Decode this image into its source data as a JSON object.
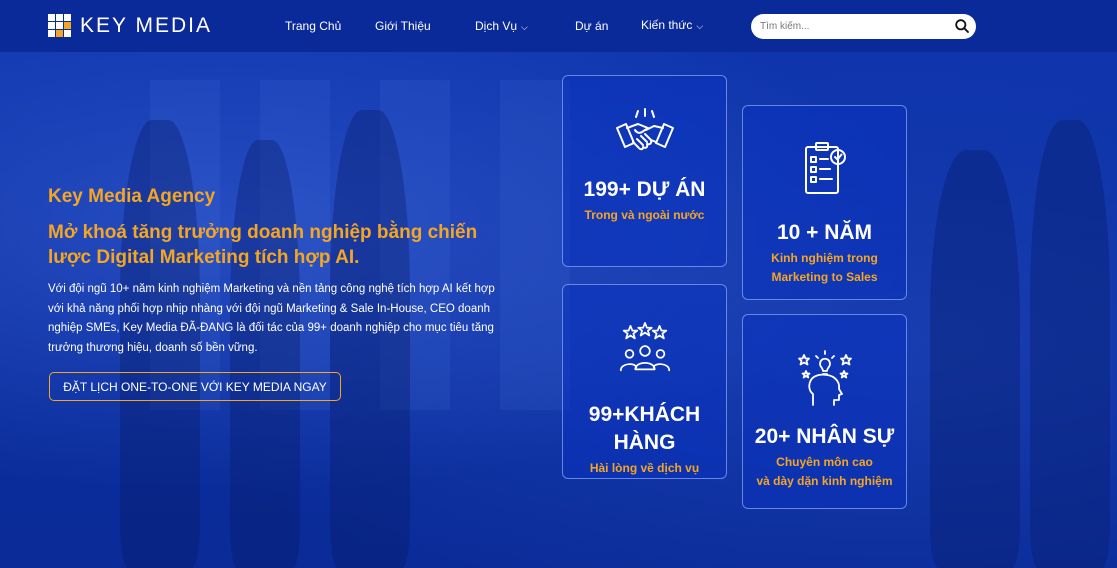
{
  "brand": {
    "name": "KEY MEDIA"
  },
  "nav": {
    "items": [
      {
        "label": "Trang Chủ",
        "has_dropdown": false
      },
      {
        "label": "Giới Thiệu",
        "has_dropdown": false
      },
      {
        "label": "Dịch Vụ",
        "has_dropdown": true
      },
      {
        "label": "Dự án",
        "has_dropdown": false
      },
      {
        "label": "Kiến thức",
        "has_dropdown": true
      }
    ],
    "dropdown_icon": "chevron-down-icon"
  },
  "search": {
    "placeholder": "Tìm kiếm...",
    "icon": "search-icon"
  },
  "hero": {
    "eyebrow": "Key Media Agency",
    "headline": "Mở khoá tăng trưởng doanh nghiệp bằng chiến lược Digital Marketing tích hợp AI.",
    "description": "Với đội ngũ 10+ năm kinh nghiệm Marketing và nền tảng công nghệ tích hợp AI kết hợp với khả năng phối hợp nhịp nhàng với đội ngũ Marketing & Sale In-House, CEO doanh nghiệp SMEs, Key Media ĐÃ-ĐANG là đối tác của 99+ doanh nghiệp cho mục tiêu tăng trưởng thương hiệu, doanh số bền vững.",
    "cta_label": "ĐẶT LỊCH ONE-TO-ONE VỚI KEY MEDIA NGAY"
  },
  "stats": [
    {
      "icon": "handshake-icon",
      "value": "199+ DỰ ÁN",
      "caption_1": "Trong và ngoài nước",
      "caption_2": ""
    },
    {
      "icon": "checklist-icon",
      "value": "10 + NĂM",
      "caption_1": "Kinh nghiệm trong",
      "caption_2": "Marketing to Sales"
    },
    {
      "icon": "customers-stars-icon",
      "value_1": "99+KHÁCH",
      "value_2": "HÀNG",
      "caption_1": "Hài lòng về dịch vụ",
      "caption_2": ""
    },
    {
      "icon": "expert-idea-icon",
      "value": "20+ NHÂN SỰ",
      "caption_1": "Chuyên môn cao",
      "caption_2": "và dày dặn kinh nghiệm"
    }
  ],
  "colors": {
    "header": "#0a2a9a",
    "background": "#0b2fa0",
    "accent": "#f4a623",
    "logo_accent": "#f4a623"
  }
}
